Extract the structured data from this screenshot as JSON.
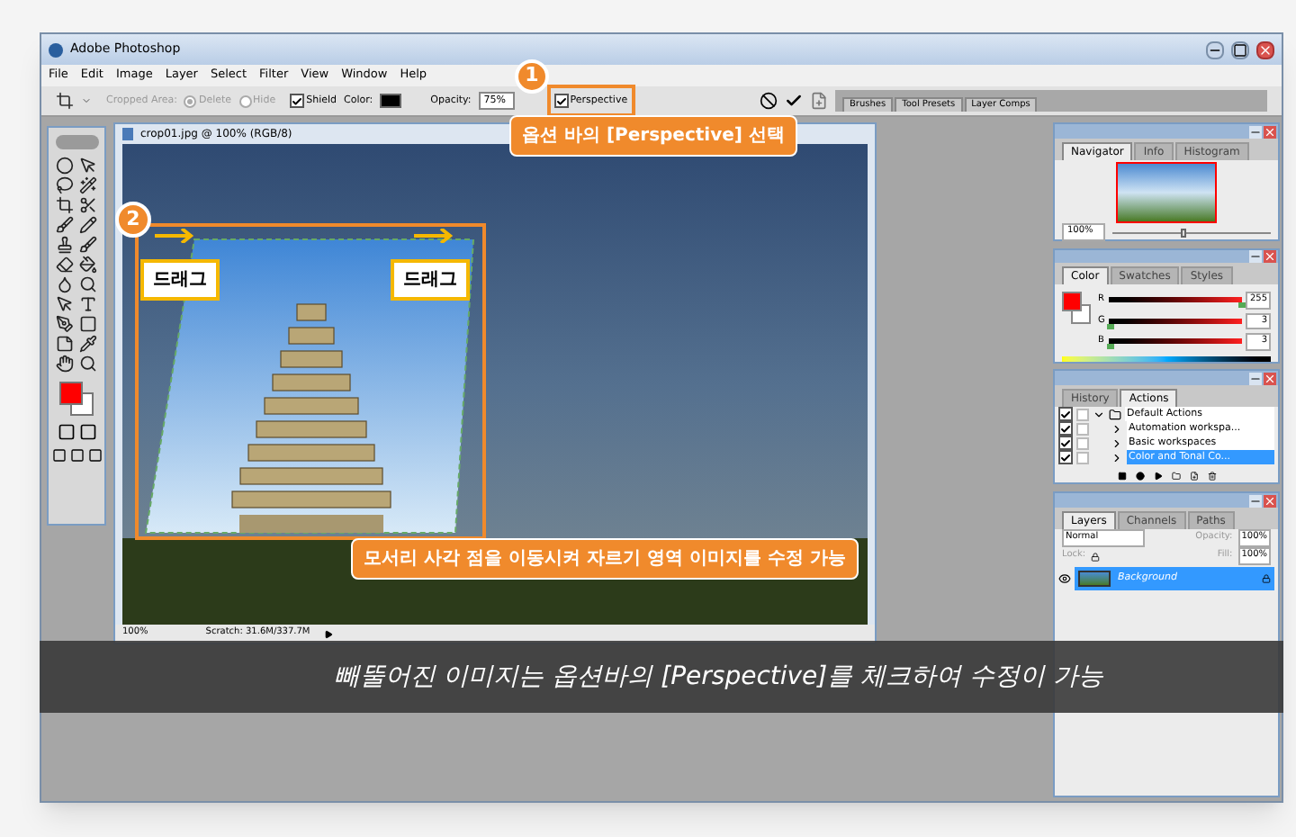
{
  "window": {
    "title": "Adobe Photoshop"
  },
  "menu": [
    "File",
    "Edit",
    "Image",
    "Layer",
    "Select",
    "Filter",
    "View",
    "Window",
    "Help"
  ],
  "options_bar": {
    "cropped_area_label": "Cropped Area:",
    "radios": [
      {
        "label": "Delete",
        "selected": true
      },
      {
        "label": "Hide",
        "selected": false
      }
    ],
    "shield": {
      "label": "Shield",
      "checked": true
    },
    "color_label": "Color:",
    "opacity_label": "Opacity:",
    "opacity_value": "75%",
    "perspective": {
      "label": "Perspective",
      "checked": true
    }
  },
  "palette_well_tabs": [
    "Brushes",
    "Tool Presets",
    "Layer Comps"
  ],
  "document": {
    "title": "crop01.jpg @ 100% (RGB/8)",
    "zoom": "100%",
    "status": "Scratch: 31.6M/337.7M"
  },
  "navigator": {
    "tabs": [
      {
        "label": "Navigator",
        "selected": true
      },
      {
        "label": "Info",
        "selected": false
      },
      {
        "label": "Histogram",
        "selected": false
      }
    ],
    "zoom": "100%",
    "slider": {
      "level": 0.45
    }
  },
  "color": {
    "tabs": [
      {
        "label": "Color",
        "selected": true
      },
      {
        "label": "Swatches",
        "selected": false
      },
      {
        "label": "Styles",
        "selected": false
      }
    ],
    "channels": [
      {
        "label": "R",
        "value": "255",
        "level": 1
      },
      {
        "label": "G",
        "value": "3",
        "level": 0.01
      },
      {
        "label": "B",
        "value": "3",
        "level": 0.01
      }
    ]
  },
  "actions": {
    "tabs": [
      {
        "label": "History",
        "selected": false
      },
      {
        "label": "Actions",
        "selected": true
      }
    ],
    "items": [
      {
        "label": "Default Actions",
        "kind": "set",
        "checked": true,
        "selected": false
      },
      {
        "label": "Automation workspa...",
        "kind": "action",
        "checked": true,
        "selected": false
      },
      {
        "label": "Basic workspaces",
        "kind": "action",
        "checked": true,
        "selected": false
      },
      {
        "label": "Color and Tonal Co...",
        "kind": "action",
        "checked": true,
        "selected": true
      }
    ]
  },
  "layers": {
    "tabs": [
      {
        "label": "Layers",
        "selected": true
      },
      {
        "label": "Channels",
        "selected": false
      },
      {
        "label": "Paths",
        "selected": false
      }
    ],
    "blend_mode": "Normal",
    "opacity_label": "Opacity:",
    "opacity_value": "100%",
    "lock_label": "Lock:",
    "fill_label": "Fill:",
    "fill_value": "100%",
    "items": [
      {
        "name": "Background",
        "selected": true
      }
    ]
  },
  "annotations": {
    "step1": {
      "number": "1",
      "text": "옵션 바의 [Perspective] 선택"
    },
    "step2": {
      "number": "2",
      "drag_labels": [
        "드래그",
        "드래그"
      ],
      "note": "모서리 사각 점을 이동시켜 자르기 영역 이미지를 수정 가능"
    }
  },
  "caption": "빼뚤어진 이미지는 옵션바의 [Perspective]를 체크하여 수정이 가능"
}
